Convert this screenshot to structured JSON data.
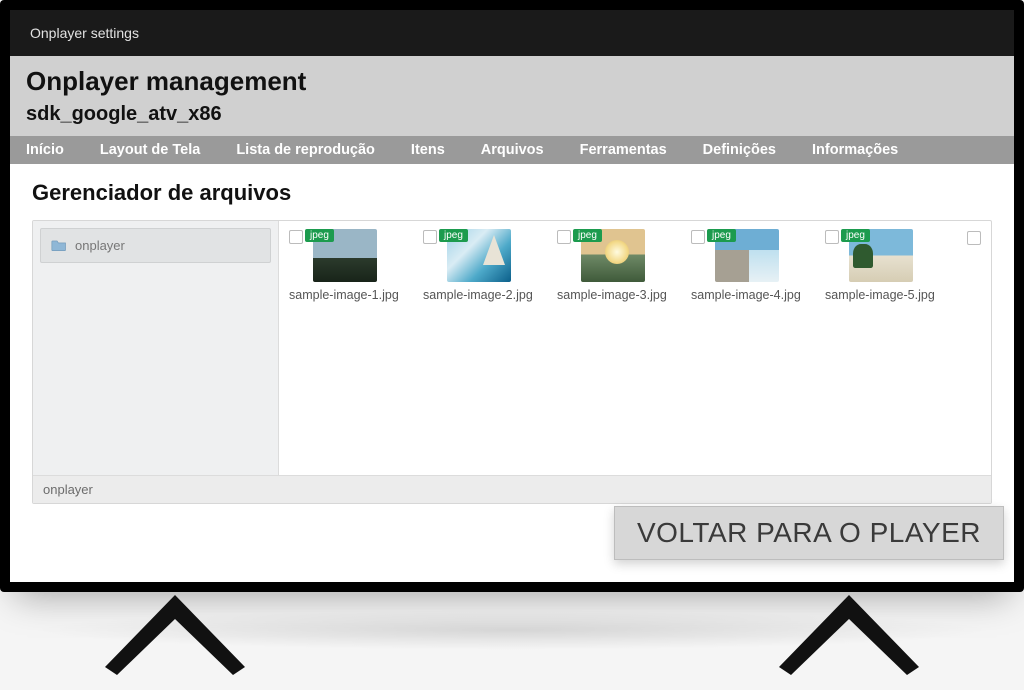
{
  "topbar": {
    "title": "Onplayer settings"
  },
  "header": {
    "title": "Onplayer management",
    "subtitle": "sdk_google_atv_x86"
  },
  "nav": {
    "items": [
      "Início",
      "Layout de Tela",
      "Lista de reprodução",
      "Itens",
      "Arquivos",
      "Ferramentas",
      "Definições",
      "Informações"
    ]
  },
  "section": {
    "title": "Gerenciador de arquivos"
  },
  "tree": {
    "root": "onplayer"
  },
  "files": {
    "items": [
      {
        "name": "sample-image-1.jpg",
        "badge": "jpeg",
        "thumb": "th-0"
      },
      {
        "name": "sample-image-2.jpg",
        "badge": "jpeg",
        "thumb": "th-1"
      },
      {
        "name": "sample-image-3.jpg",
        "badge": "jpeg",
        "thumb": "th-2"
      },
      {
        "name": "sample-image-4.jpg",
        "badge": "jpeg",
        "thumb": "th-3"
      },
      {
        "name": "sample-image-5.jpg",
        "badge": "jpeg",
        "thumb": "th-4"
      }
    ]
  },
  "breadcrumb": {
    "path": "onplayer"
  },
  "back_button": {
    "label": "VOLTAR PARA O PLAYER"
  }
}
